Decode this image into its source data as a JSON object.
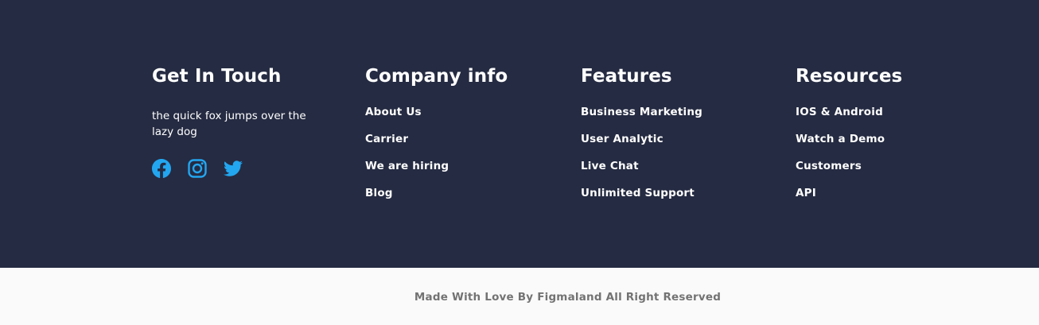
{
  "colors": {
    "footer_bg": "#252B42",
    "bottom_bg": "#FAFAFA",
    "text_light": "#FFFFFF",
    "text_muted": "#737373",
    "icon_blue": "#23A6F0"
  },
  "get_in_touch": {
    "title": "Get In Touch",
    "description": "the quick fox jumps over the lazy dog",
    "social": [
      "facebook-icon",
      "instagram-icon",
      "twitter-icon"
    ]
  },
  "company_info": {
    "title": "Company info",
    "links": [
      "About Us",
      "Carrier",
      "We are hiring",
      "Blog"
    ]
  },
  "features": {
    "title": "Features",
    "links": [
      "Business Marketing",
      "User Analytic",
      "Live Chat",
      "Unlimited Support"
    ]
  },
  "resources": {
    "title": "Resources",
    "links": [
      "IOS & Android",
      "Watch a Demo",
      "Customers",
      "API"
    ]
  },
  "bottom": {
    "copyright": "Made With Love By Figmaland All Right Reserved"
  }
}
